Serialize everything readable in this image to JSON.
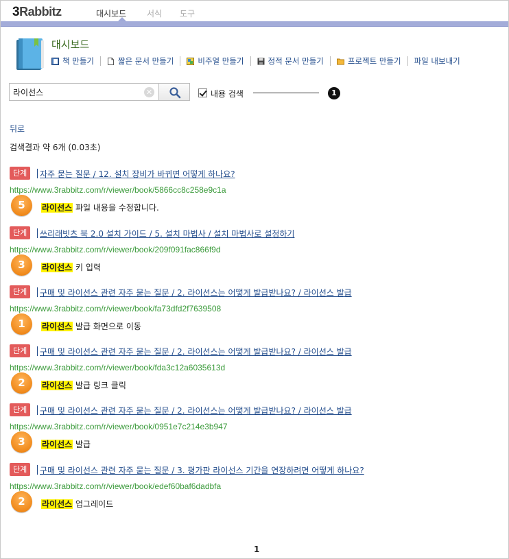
{
  "app": {
    "logo_num": "3",
    "logo_rest": "Rabbitz",
    "tabs": [
      {
        "label": "대시보드"
      },
      {
        "label": "서식"
      },
      {
        "label": "도구"
      }
    ]
  },
  "dashboard": {
    "title": "대시보드",
    "icon": "book-icon",
    "toolbar": [
      {
        "label": "책 만들기",
        "icon": "book-small-icon"
      },
      {
        "label": "짧은 문서 만들기",
        "icon": "document-icon"
      },
      {
        "label": "비주얼 만들기",
        "icon": "visual-icon"
      },
      {
        "label": "정적 문서 만들기",
        "icon": "save-icon"
      },
      {
        "label": "프로젝트 만들기",
        "icon": "folder-icon"
      },
      {
        "label": "파일 내보내기",
        "icon": ""
      }
    ]
  },
  "search": {
    "value": "라이선스",
    "clear_icon": "✕",
    "button_icon": "search-icon",
    "content_search_label": "내용 검색",
    "content_search_checked": true,
    "callout": "1"
  },
  "back_label": "뒤로",
  "summary": "검색결과 약 6개 (0.03초)",
  "results": [
    {
      "badge": "단계",
      "title": "자주 묻는 질문 / 12. 설치 장비가 바뀌면 어떻게 하나요?",
      "url": "https://www.3rabbitz.com/r/viewer/book/5866cc8c258e9c1a",
      "step": "5",
      "highlight": "라이선스",
      "rest": " 파일 내용을 수정합니다."
    },
    {
      "badge": "단계",
      "title": "쓰리래빗츠 북 2.0 설치 가이드 / 5. 설치 마법사 / 설치 마법사로 설정하기",
      "url": "https://www.3rabbitz.com/r/viewer/book/209f091fac866f9d",
      "step": "3",
      "highlight": "라이선스",
      "rest": " 키 입력"
    },
    {
      "badge": "단계",
      "title": "구매 및 라이선스 관련 자주 묻는 질문 / 2. 라이선스는 어떻게 발급받나요? / 라이선스 발급",
      "url": "https://www.3rabbitz.com/r/viewer/book/fa73dfd2f7639508",
      "step": "1",
      "highlight": "라이선스",
      "rest": " 발급 화면으로 이동"
    },
    {
      "badge": "단계",
      "title": "구매 및 라이선스 관련 자주 묻는 질문 / 2. 라이선스는 어떻게 발급받나요? / 라이선스 발급",
      "url": "https://www.3rabbitz.com/r/viewer/book/fda3c12a6035613d",
      "step": "2",
      "highlight": "라이선스",
      "rest": " 발급 링크 클릭"
    },
    {
      "badge": "단계",
      "title": "구매 및 라이선스 관련 자주 묻는 질문 / 2. 라이선스는 어떻게 발급받나요? / 라이선스 발급",
      "url": "https://www.3rabbitz.com/r/viewer/book/0951e7c214e3b947",
      "step": "3",
      "highlight": "라이선스",
      "rest": " 발급"
    },
    {
      "badge": "단계",
      "title": "구매 및 라이선스 관련 자주 묻는 질문 / 3. 평가판 라이선스 기간을 연장하려면 어떻게 하나요?",
      "url": "https://www.3rabbitz.com/r/viewer/book/edef60baf6dadbfa",
      "step": "2",
      "highlight": "라이선스",
      "rest": " 업그레이드"
    }
  ],
  "pager": {
    "current": "1"
  },
  "colors": {
    "accent_bar": "#a3acd9",
    "badge": "#e35b5b",
    "url": "#3a9a3a",
    "highlight": "#fff200",
    "step": "#f08a1c"
  }
}
